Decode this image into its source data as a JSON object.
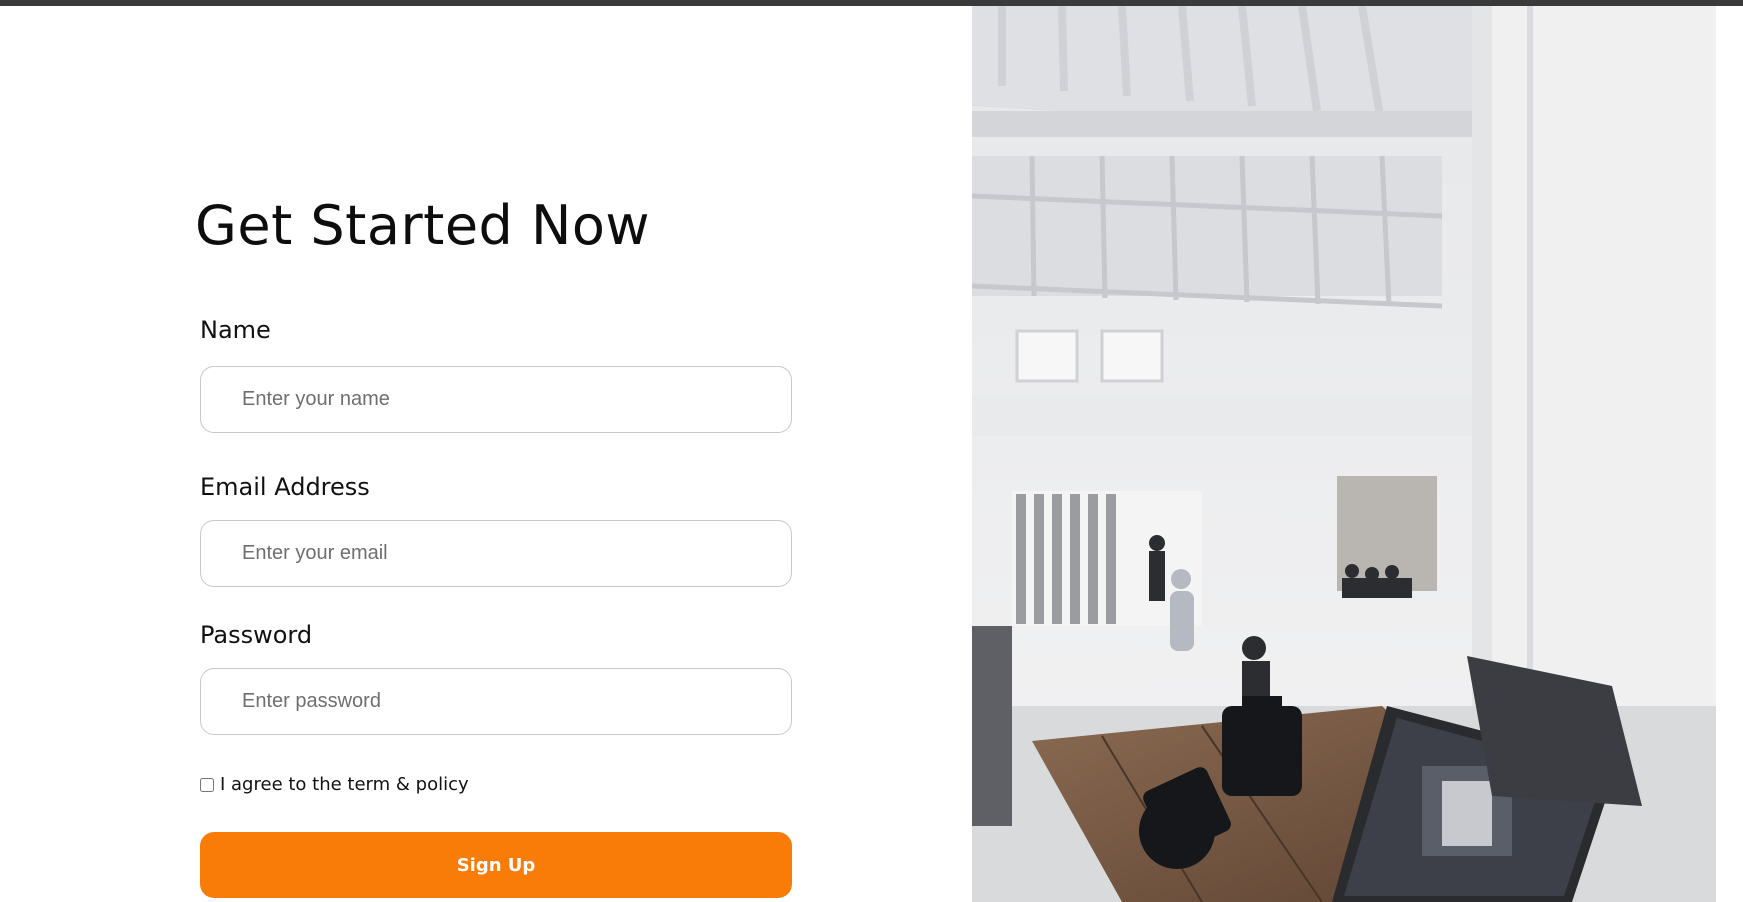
{
  "form": {
    "title": "Get Started Now",
    "name": {
      "label": "Name",
      "placeholder": "Enter your name",
      "value": ""
    },
    "email": {
      "label": "Email Address",
      "placeholder": "Enter your email",
      "value": ""
    },
    "password": {
      "label": "Password",
      "placeholder": "Enter password",
      "value": ""
    },
    "agree": {
      "label": "I agree to the term & policy",
      "checked": false
    },
    "submit_label": "Sign Up"
  },
  "colors": {
    "accent": "#f97c08",
    "field_border": "#c9c9c9",
    "top_bar": "#3a3a3a"
  },
  "hero_image": {
    "icon": "studio-photo-image"
  }
}
